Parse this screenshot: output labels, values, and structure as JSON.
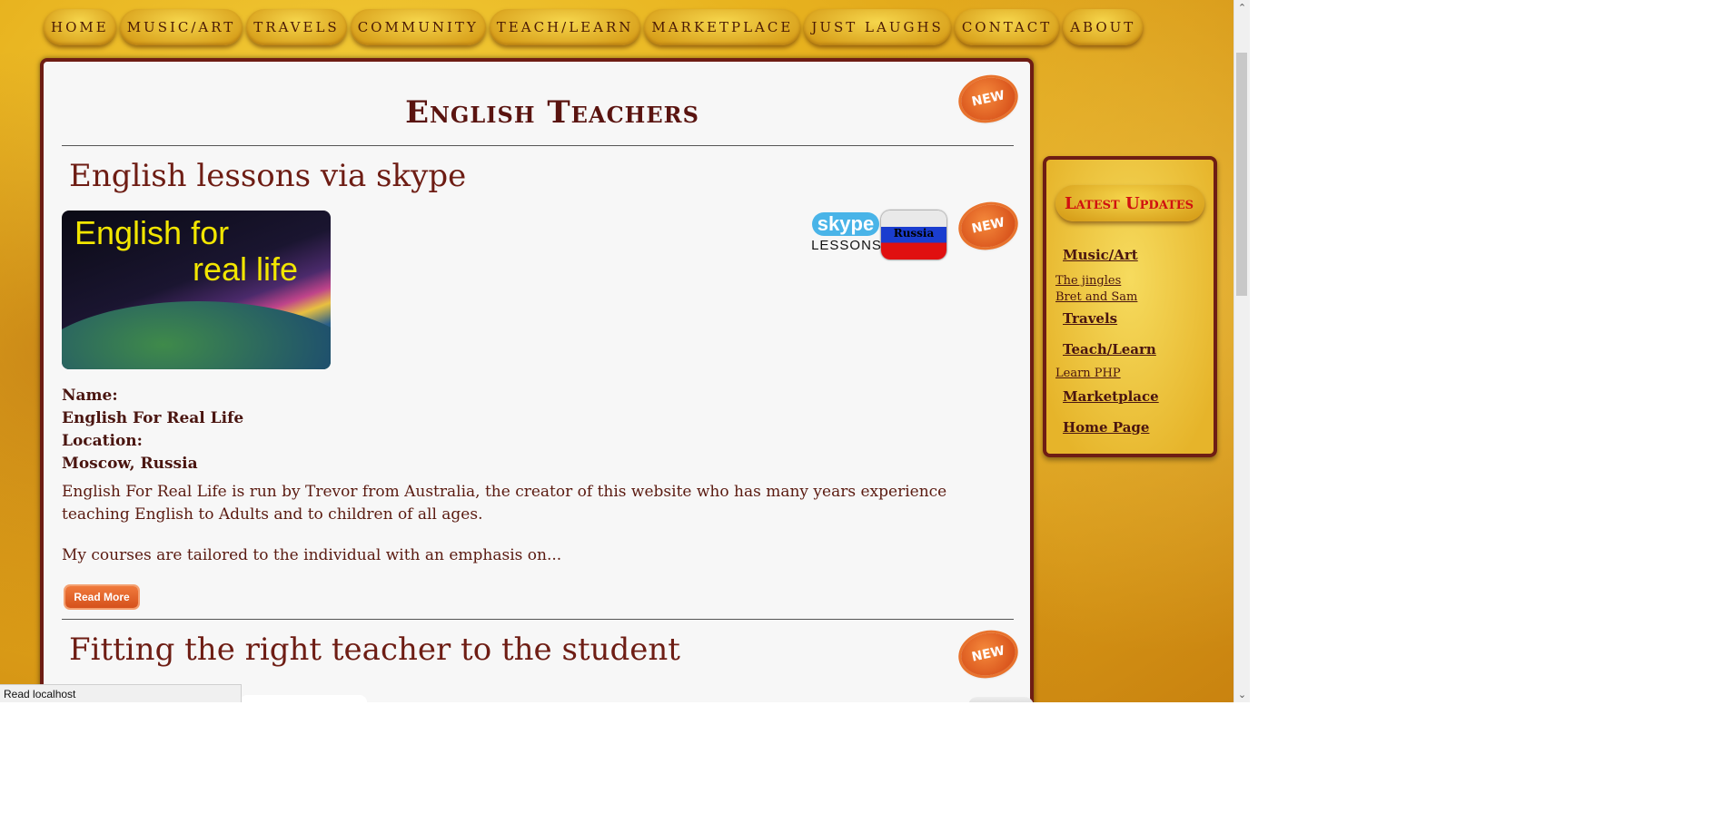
{
  "nav": [
    "HOME",
    "MUSIC/ART",
    "TRAVELS",
    "COMMUNITY",
    "TEACH/LEARN",
    "MARKETPLACE",
    "JUST LAUGHS",
    "CONTACT",
    "ABOUT"
  ],
  "badges": {
    "new": "NEW"
  },
  "page": {
    "title": "English Teachers"
  },
  "article1": {
    "title": "English lessons via skype",
    "thumb_line1": "English for",
    "thumb_line2": "real life",
    "skype_logo_word": "skype",
    "skype_logo_sub": "LESSONS",
    "flag_label": "Russia",
    "name_label": "Name:",
    "name_value": "English For Real Life",
    "location_label": "Location:",
    "location_value": "Moscow, Russia",
    "para1": "English For Real Life is run by Trevor from Australia, the creator of this website who has many years experience teaching English to Adults and to children of all ages.",
    "para2": "My courses are tailored to the individual with an emphasis on...",
    "read_more": "Read More"
  },
  "article2": {
    "title": "Fitting the right teacher to the student"
  },
  "sidebar": {
    "heading": "Latest Updates",
    "music_art": "Music/Art",
    "item_jingles": "The jingles",
    "item_bret": "Bret and Sam",
    "travels": "Travels",
    "teach_learn": "Teach/Learn",
    "item_php": "Learn PHP",
    "marketplace": "Marketplace",
    "home_page": "Home Page"
  },
  "status_bar": "Read localhost",
  "icons": {
    "scroll_up": "chevron-up-icon",
    "scroll_down": "chevron-down-icon"
  },
  "colors": {
    "brand_dark": "#6e1d14",
    "accent_orange": "#d9541c",
    "background_gold": "#e8b31f"
  }
}
